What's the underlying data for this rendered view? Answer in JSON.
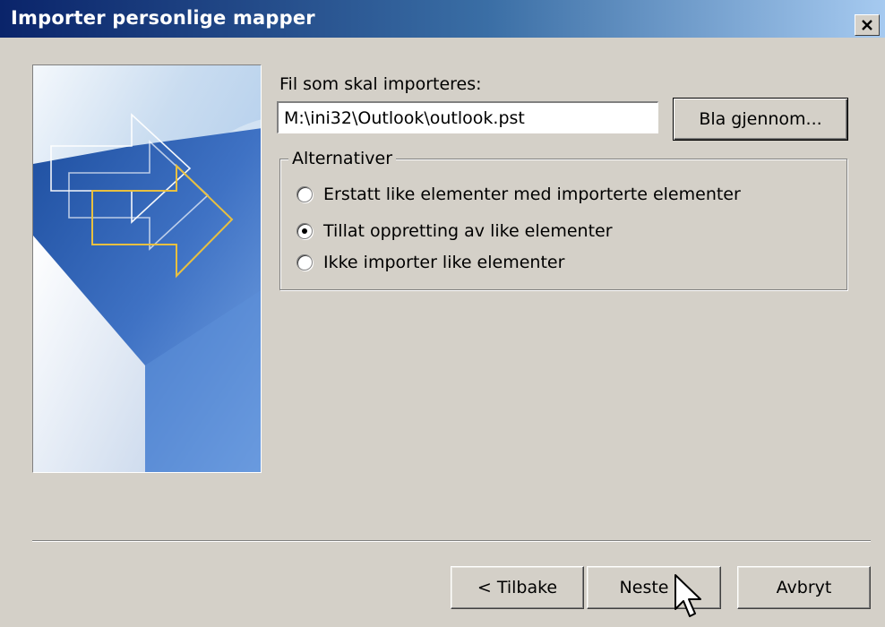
{
  "window": {
    "title": "Importer personlige mapper",
    "close_icon": "close-icon"
  },
  "banner": {
    "icon": "import-arrows-banner"
  },
  "file": {
    "label": "Fil som skal importeres:",
    "value": "M:\\ini32\\Outlook\\outlook.pst",
    "browse_label": "Bla gjennom..."
  },
  "options": {
    "legend": "Alternativer",
    "items": [
      {
        "label": "Erstatt like elementer med importerte elementer",
        "checked": false
      },
      {
        "label": "Tillat oppretting av like elementer",
        "checked": true
      },
      {
        "label": "Ikke importer like elementer",
        "checked": false
      }
    ]
  },
  "buttons": {
    "back": "< Tilbake",
    "next": "Neste >",
    "cancel": "Avbryt"
  },
  "colors": {
    "title_start": "#0a246a",
    "title_end": "#a6caf0",
    "dialog_bg": "#d4d0c8",
    "banner_accent": "#e8c040"
  }
}
